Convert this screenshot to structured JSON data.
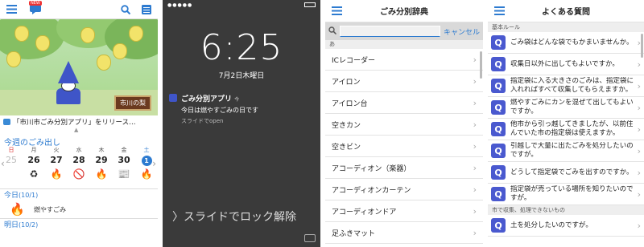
{
  "panel1": {
    "new_badge": "NEW",
    "hero_sign": "市川の梨",
    "news": "「市川市ごみ分別アプリ」をリリース…",
    "week_title": "今週のごみ出し",
    "days": [
      {
        "dow": "日",
        "date": "25",
        "icon": "",
        "kind": "sun"
      },
      {
        "dow": "月",
        "date": "26",
        "icon": "♻",
        "kind": ""
      },
      {
        "dow": "火",
        "date": "27",
        "icon": "🔥",
        "kind": ""
      },
      {
        "dow": "水",
        "date": "28",
        "icon": "🚫",
        "kind": ""
      },
      {
        "dow": "木",
        "date": "29",
        "icon": "🔥",
        "kind": ""
      },
      {
        "dow": "金",
        "date": "30",
        "icon": "📰",
        "kind": ""
      },
      {
        "dow": "土",
        "date": "1",
        "icon": "🔥",
        "kind": "sat"
      }
    ],
    "today_label": "今日",
    "today_date": "(10/1)",
    "today_item": "燃やすごみ",
    "tomorrow_label": "明日",
    "tomorrow_date": "(10/2)"
  },
  "panel2": {
    "status": "●●●●●",
    "time": "6:25",
    "date": "7月2日木曜日",
    "notif_title": "ごみ分別アプリ",
    "notif_time": "今",
    "notif_body": "今日は燃やすごみの日です",
    "notif_hint": "スライドでopen",
    "slide": "〉スライドでロック解除"
  },
  "panel3": {
    "title": "ごみ分別辞典",
    "cancel": "キャンセル",
    "section": "あ",
    "items": [
      "ICレコーダー",
      "アイロン",
      "アイロン台",
      "空きカン",
      "空きビン",
      "アコーディオン（楽器）",
      "アコーディオンカーテン",
      "アコーディオンドア",
      "足ふきマット"
    ]
  },
  "panel4": {
    "title": "よくある質問",
    "section1": "基本ルール",
    "faqs": [
      "ごみ袋はどんな袋でもかまいませんか。",
      "収集日以外に出してもよいですか。",
      "指定袋に入る大きさのごみは、指定袋に入れればすべて収集してもらえますか。",
      "燃やすごみにカンを混ぜて出してもよいですか。",
      "他市から引っ越してきましたが、以前住んでいた市の指定袋は使えますか。",
      "引越しで大量に出たごみを処分したいのですが。",
      "どうして指定袋でごみを出すのですか。",
      "指定袋が売っている場所を知りたいのですが。"
    ],
    "section2": "市で収集、処理できないもの",
    "faq_last": "土を処分したいのですが。",
    "q_letter": "Q"
  }
}
